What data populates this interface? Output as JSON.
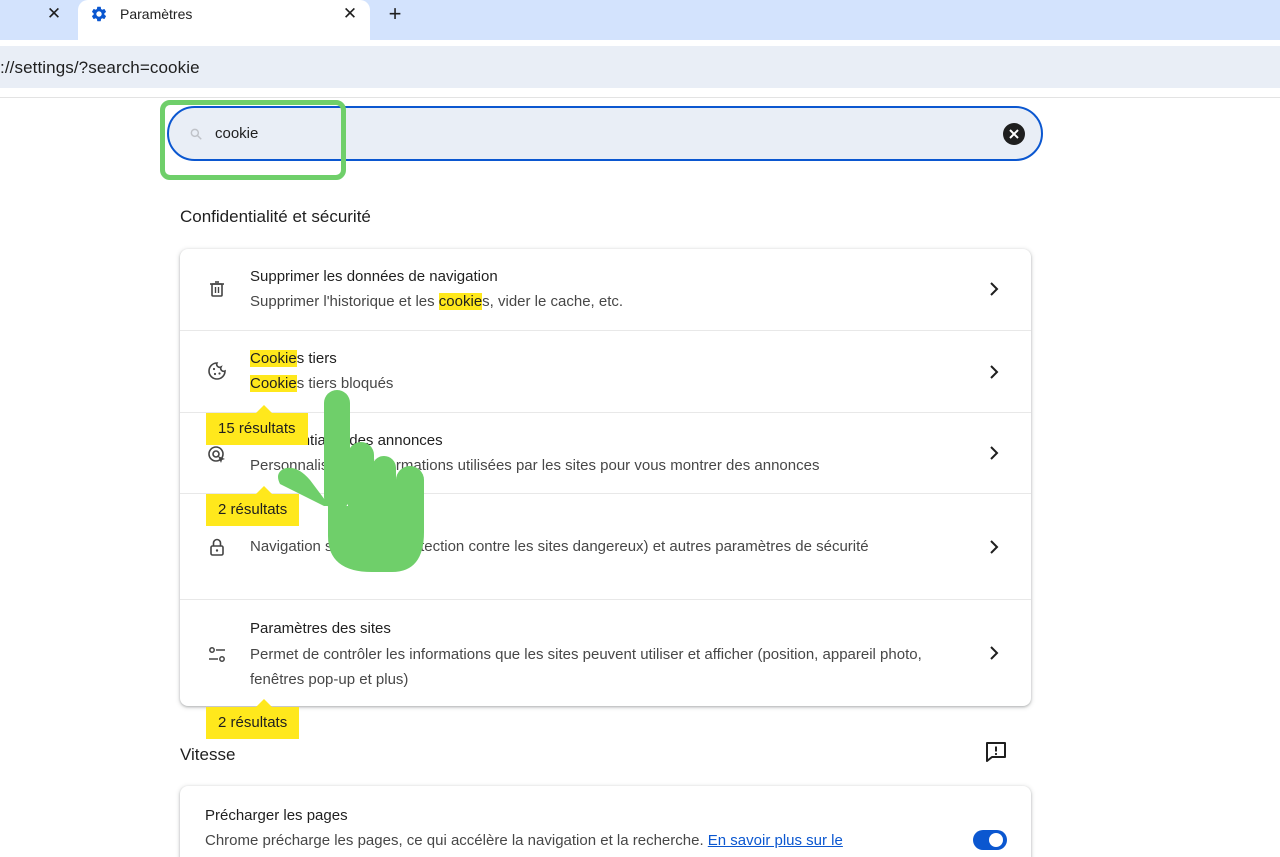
{
  "browser": {
    "prev_tab_close": "✕",
    "active_tab": {
      "title": "Paramètres",
      "close": "✕",
      "icon": "gear-icon"
    },
    "new_tab": "+",
    "url": "://settings/?search=cookie"
  },
  "search": {
    "value": "cookie",
    "icon": "search-icon",
    "clear_icon": "clear-icon"
  },
  "privacy_section": {
    "title": "Confidentialité et sécurité",
    "rows": [
      {
        "icon": "trash-icon",
        "title": "Supprimer les données de navigation",
        "sub_before": "Supprimer l'historique et les ",
        "sub_mark": "cookie",
        "sub_after": "s, vider le cache, etc."
      },
      {
        "icon": "cookie-icon",
        "title_mark": "Cookie",
        "title_after": "s tiers",
        "sub_mark": "Cookie",
        "sub_after": "s tiers bloqués"
      },
      {
        "icon": "ad-privacy-icon",
        "title": "Confidentialité des annonces",
        "sub": "Personnalisez les informations utilisées par les sites pour vous montrer des annonces"
      },
      {
        "icon": "lock-icon",
        "sub": "Navigation sécurisée (protection contre les sites dangereux) et autres paramètres de sécurité"
      },
      {
        "icon": "sliders-icon",
        "title": "Paramètres des sites",
        "sub": "Permet de contrôler les informations que les sites peuvent utiliser et afficher (position, appareil photo, fenêtres pop-up et plus)"
      }
    ],
    "bubbles": [
      "15 résultats",
      "2 résultats",
      "2 résultats"
    ]
  },
  "speed_section": {
    "title": "Vitesse",
    "feedback_icon": "feedback-icon",
    "preload": {
      "title": "Précharger les pages",
      "sub": "Chrome précharge les pages, ce qui accélère la navigation et la recherche. ",
      "link": "En savoir plus sur le",
      "toggle_on": true
    }
  },
  "colors": {
    "accent": "#0b57d0",
    "highlight": "#ffe81c",
    "annotation": "#6fcf6a",
    "tabstrip": "#d3e3fd"
  }
}
